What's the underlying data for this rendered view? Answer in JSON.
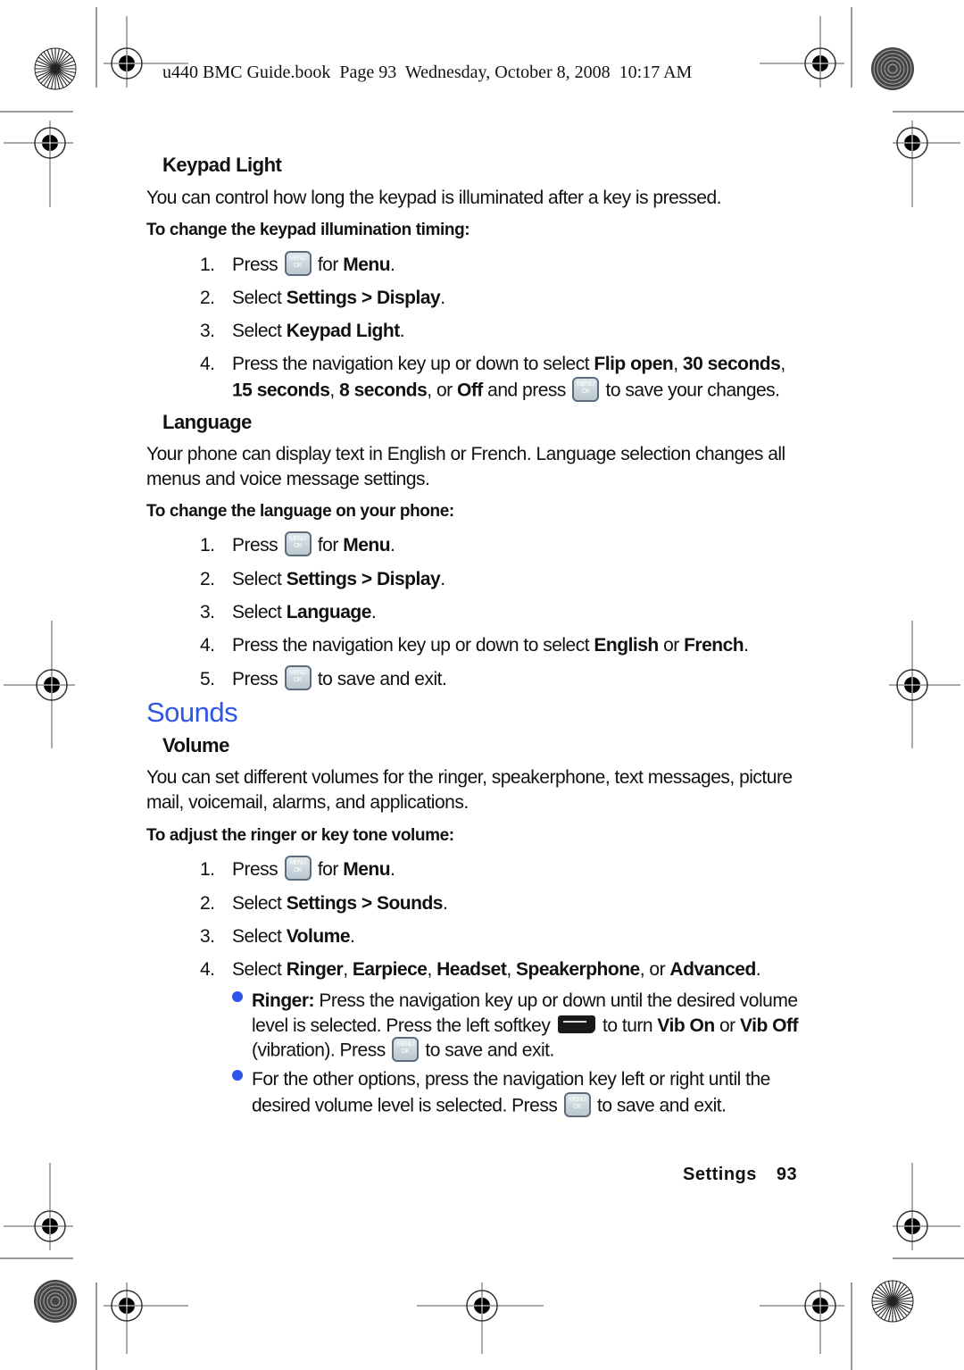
{
  "header": {
    "text": "u440 BMC Guide.book  Page 93  Wednesday, October 8, 2008  10:17 AM"
  },
  "keypad_light": {
    "heading": "Keypad Light",
    "intro": "You can control how long the keypad is illuminated after a key is pressed.",
    "procedure_title": "To change the keypad illumination timing:",
    "steps": [
      {
        "num": "1.",
        "a": "Press ",
        "b": " for ",
        "c": "Menu",
        "d": "."
      },
      {
        "num": "2.",
        "a": "Select ",
        "b": "Settings > Display",
        "c": "."
      },
      {
        "num": "3.",
        "a": "Select ",
        "b": "Keypad Light",
        "c": "."
      },
      {
        "num": "4.",
        "a": "Press the navigation key up or down to select ",
        "b": "Flip open",
        "c": ", ",
        "d": "30 seconds",
        "e": ",",
        "line2": {
          "a": "15 seconds",
          "b": ", ",
          "c": "8 seconds",
          "d": ", or ",
          "e": "Off",
          "f": " and press ",
          "g": " to save your changes."
        }
      }
    ]
  },
  "language": {
    "heading": "Language",
    "intro_line1": "Your phone can display text in English or French. Language selection changes all",
    "intro_line2": "menus and voice message settings.",
    "procedure_title": "To change the language on your phone:",
    "steps": [
      {
        "num": "1.",
        "a": "Press ",
        "b": " for ",
        "c": "Menu",
        "d": "."
      },
      {
        "num": "2.",
        "a": "Select ",
        "b": "Settings > Display",
        "c": "."
      },
      {
        "num": "3.",
        "a": "Select ",
        "b": "Language",
        "c": "."
      },
      {
        "num": "4.",
        "a": "Press the navigation key up or down to select ",
        "b": "English",
        "c": " or ",
        "d": "French",
        "e": "."
      },
      {
        "num": "5.",
        "a": "Press ",
        "b": " to save and exit."
      }
    ]
  },
  "sounds": {
    "title": "Sounds",
    "title_color": "#2f55e6",
    "volume": {
      "heading": "Volume",
      "intro_line1": "You can set different volumes for the ringer, speakerphone, text messages, picture",
      "intro_line2": "mail, voicemail, alarms, and applications.",
      "procedure_title": "To adjust the ringer or key tone volume:",
      "steps": [
        {
          "num": "1.",
          "a": "Press ",
          "b": " for ",
          "c": "Menu",
          "d": "."
        },
        {
          "num": "2.",
          "a": "Select ",
          "b": "Settings > Sounds",
          "c": "."
        },
        {
          "num": "3.",
          "a": "Select ",
          "b": "Volume",
          "c": "."
        },
        {
          "num": "4.",
          "a": "Select ",
          "b": "Ringer",
          "c": ", ",
          "d": "Earpiece",
          "e": ", ",
          "f": "Headset",
          "g": ", ",
          "h": "Speakerphone",
          "i": ", or ",
          "j": "Advanced",
          "k": "."
        }
      ],
      "bullets": [
        {
          "line1_bold": "Ringer:",
          "line1": " Press the navigation key up or down until the desired volume",
          "line2_a": "level is selected. Press the left softkey ",
          "line2_b": " to turn ",
          "line2_c": "Vib On",
          "line2_d": " or ",
          "line2_e": "Vib Off",
          "line3_a": "(vibration). Press ",
          "line3_b": " to save and exit."
        },
        {
          "line1": "For the other options, press the navigation key left or right until the",
          "line2_a": "desired volume level is selected. Press ",
          "line2_b": " to save and exit."
        }
      ]
    }
  },
  "footer": {
    "section": "Settings",
    "page": "93"
  },
  "icons": {
    "menu_ok_key": "menu-ok-key-icon",
    "left_softkey": "left-softkey-icon",
    "registration_mark": "registration-mark-icon",
    "color_bar_starburst": "starburst-icon",
    "color_bar_concentric": "concentric-circle-icon"
  }
}
